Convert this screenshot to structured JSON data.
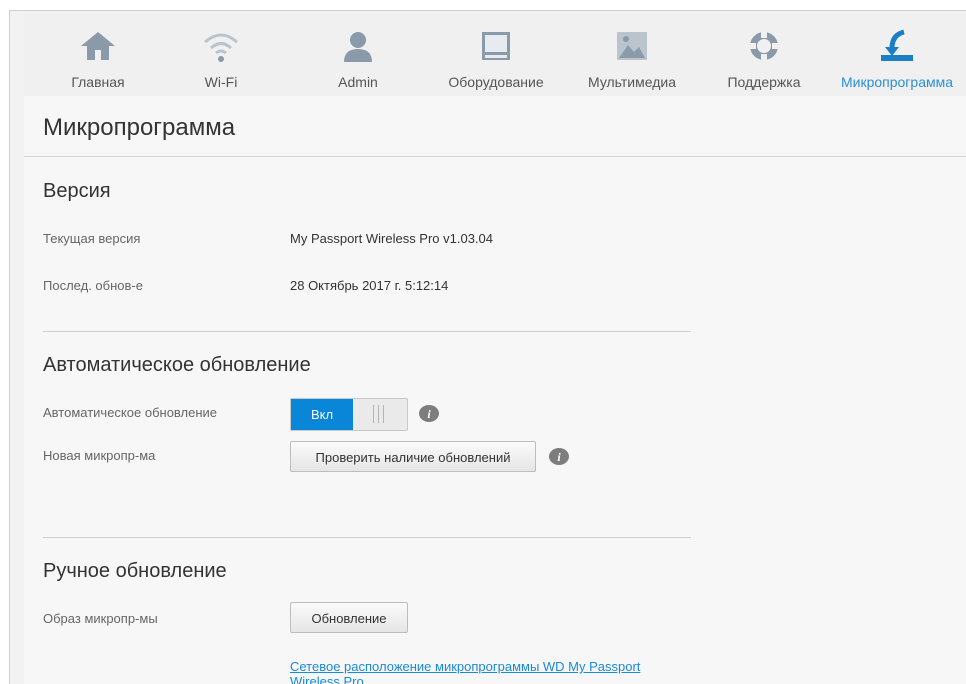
{
  "nav": {
    "items": [
      {
        "label": "Главная",
        "icon": "home-icon"
      },
      {
        "label": "Wi-Fi",
        "icon": "wifi-icon"
      },
      {
        "label": "Admin",
        "icon": "user-icon"
      },
      {
        "label": "Оборудование",
        "icon": "hardware-icon"
      },
      {
        "label": "Мультимедиа",
        "icon": "media-icon"
      },
      {
        "label": "Поддержка",
        "icon": "lifebuoy-icon"
      },
      {
        "label": "Микропрограмма",
        "icon": "firmware-download-icon"
      }
    ],
    "active_index": 6,
    "active_color": "#2a8fd6",
    "icon_color": "#8a9aa8"
  },
  "page": {
    "title": "Микропрограмма"
  },
  "version": {
    "heading": "Версия",
    "current_label": "Текущая версия",
    "current_value": "My Passport Wireless Pro v1.03.04",
    "last_label": "Послед. обнов-е",
    "last_value": "28 Октябрь 2017 г. 5:12:14"
  },
  "auto_update": {
    "heading": "Автоматическое обновление",
    "toggle_label": "Автоматическое обновление",
    "toggle_on_text": "Вкл",
    "toggle_state": "on",
    "new_label": "Новая микропр-ма",
    "check_button": "Проверить наличие обновлений"
  },
  "manual_update": {
    "heading": "Ручное обновление",
    "image_label": "Образ микропр-мы",
    "update_button": "Обновление",
    "link_text": "Сетевое расположение микропрограммы WD My Passport Wireless Pro"
  },
  "colors": {
    "accent": "#0a86d8",
    "link": "#1a8ad8"
  }
}
